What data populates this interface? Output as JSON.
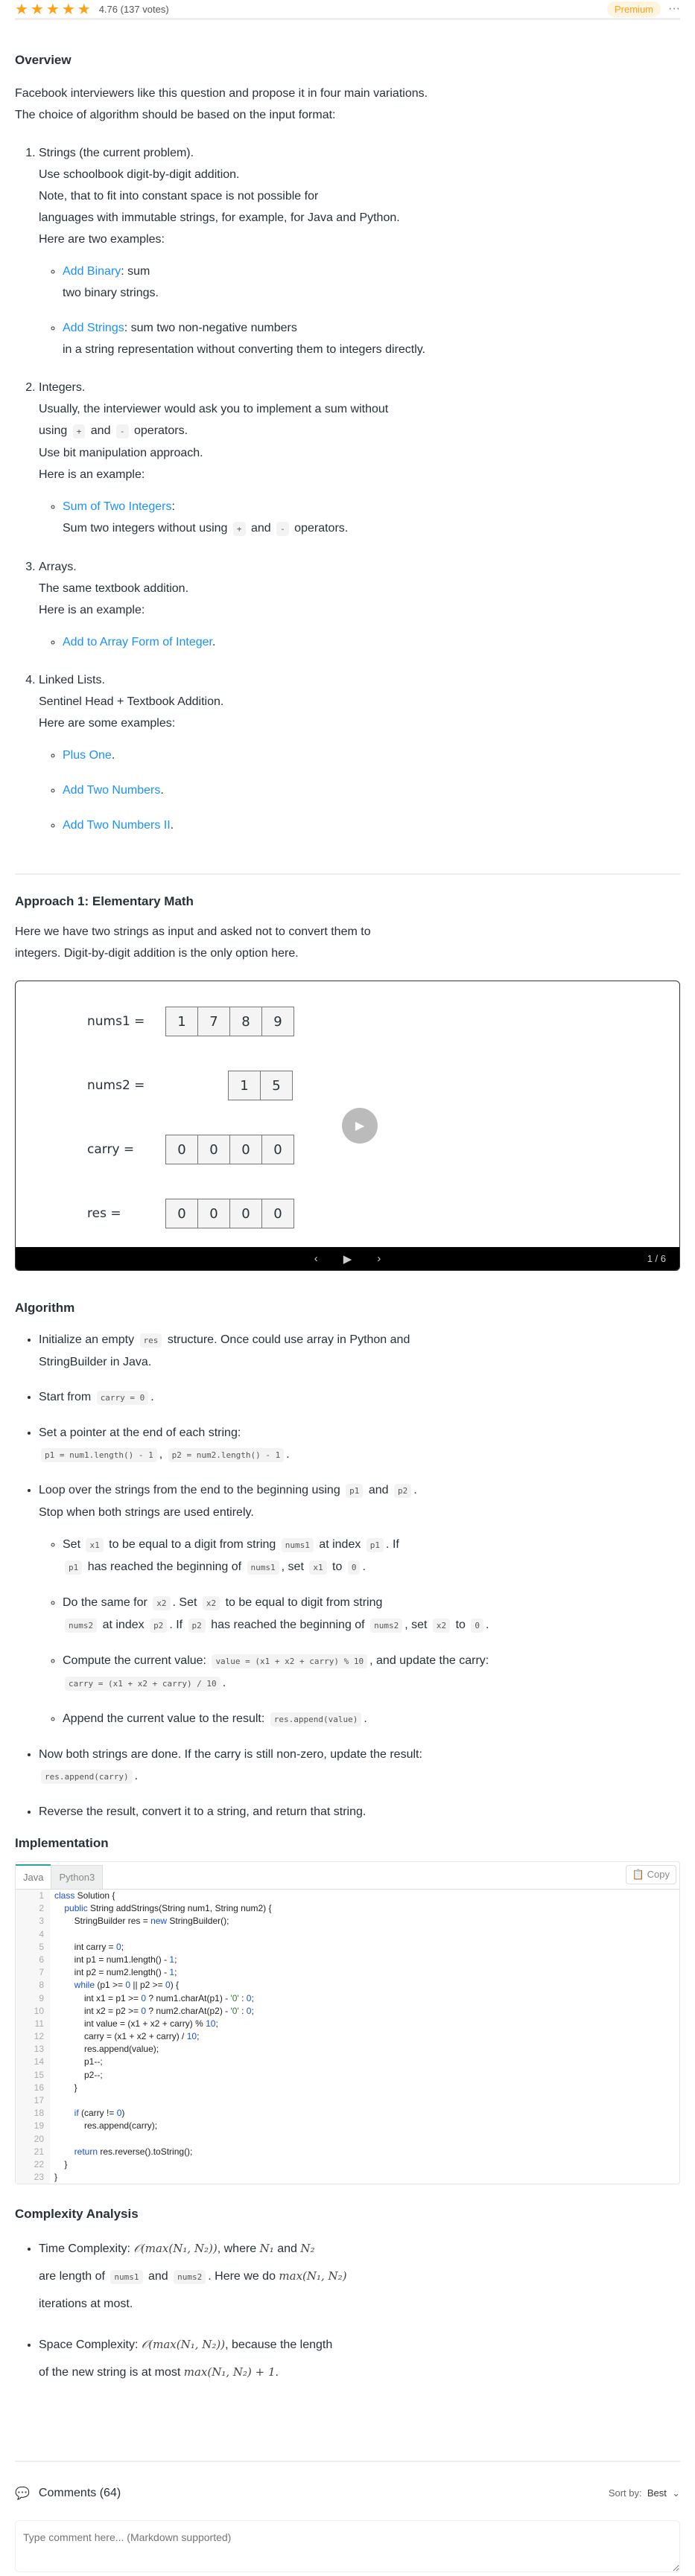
{
  "header": {
    "stars": 5,
    "rating": "4.76",
    "votes": "(137 votes)",
    "premium": "Premium",
    "more": "···"
  },
  "overview": {
    "title": "Overview",
    "intro1": "Facebook interviewers like this question and propose it in four main variations.",
    "intro2": "The choice of algorithm should be based on the input format:",
    "items": [
      {
        "lines": [
          [
            {
              "t": "Strings (the current problem)."
            }
          ],
          [
            {
              "t": "Use schoolbook digit-by-digit addition."
            }
          ],
          [
            {
              "t": "Note, that to fit into constant space is not possible for"
            }
          ],
          [
            {
              "t": "languages with immutable strings, for example, for Java and Python."
            }
          ],
          [
            {
              "t": "Here are two examples:"
            }
          ]
        ],
        "sub": [
          [
            {
              "l": "Add Binary"
            },
            {
              "t": ": sum"
            },
            {
              "br": 1
            },
            {
              "t": "two binary strings."
            }
          ],
          [
            {
              "l": "Add Strings"
            },
            {
              "t": ": sum two non-negative numbers"
            },
            {
              "br": 1
            },
            {
              "t": "in a string representation without converting them to integers directly."
            }
          ]
        ]
      },
      {
        "lines": [
          [
            {
              "t": "Integers."
            }
          ],
          [
            {
              "t": "Usually, the interviewer would ask you to implement a sum without"
            }
          ],
          [
            {
              "t": "using "
            },
            {
              "c": "+"
            },
            {
              "t": " and "
            },
            {
              "c": "-"
            },
            {
              "t": " operators."
            }
          ],
          [
            {
              "t": "Use bit manipulation approach."
            }
          ],
          [
            {
              "t": "Here is an example:"
            }
          ]
        ],
        "sub": [
          [
            {
              "l": "Sum of Two Integers"
            },
            {
              "t": ":"
            },
            {
              "br": 1
            },
            {
              "t": "Sum two integers without using "
            },
            {
              "c": "+"
            },
            {
              "t": " and "
            },
            {
              "c": "-"
            },
            {
              "t": " operators."
            }
          ]
        ]
      },
      {
        "lines": [
          [
            {
              "t": "Arrays."
            }
          ],
          [
            {
              "t": "The same textbook addition."
            }
          ],
          [
            {
              "t": "Here is an example:"
            }
          ]
        ],
        "sub": [
          [
            {
              "l": "Add to Array Form of Integer"
            },
            {
              "t": "."
            }
          ]
        ]
      },
      {
        "lines": [
          [
            {
              "t": "Linked Lists."
            }
          ],
          [
            {
              "t": "Sentinel Head + Textbook Addition."
            }
          ],
          [
            {
              "t": "Here are some examples:"
            }
          ]
        ],
        "sub": [
          [
            {
              "l": "Plus One"
            },
            {
              "t": "."
            }
          ],
          [
            {
              "l": "Add Two Numbers"
            },
            {
              "t": "."
            }
          ],
          [
            {
              "l": "Add Two Numbers II"
            },
            {
              "t": "."
            }
          ]
        ]
      }
    ]
  },
  "approach": {
    "title": "Approach 1: Elementary Math",
    "intro1": "Here we have two strings as input and asked not to convert them to",
    "intro2": "integers. Digit-by-digit addition is the only option here."
  },
  "animation": {
    "rows": [
      {
        "label": "nums1 =",
        "cells": [
          "1",
          "7",
          "8",
          "9"
        ]
      },
      {
        "label": "nums2 =",
        "cells": [
          "1",
          "5"
        ]
      },
      {
        "label": "carry =",
        "cells": [
          "0",
          "0",
          "0",
          "0"
        ]
      },
      {
        "label": "res =",
        "cells": [
          "0",
          "0",
          "0",
          "0"
        ]
      }
    ],
    "page": "1 / 6"
  },
  "algorithm": {
    "title": "Algorithm",
    "items": [
      [
        {
          "t": "Initialize an empty "
        },
        {
          "c": "res"
        },
        {
          "t": " structure. Once could use array in Python and"
        },
        {
          "br": 1
        },
        {
          "t": "StringBuilder in Java."
        }
      ],
      [
        {
          "t": "Start from "
        },
        {
          "c": "carry = 0"
        },
        {
          "t": "."
        }
      ],
      [
        {
          "t": "Set a pointer at the end of each string:"
        },
        {
          "br": 1
        },
        {
          "c": "p1 = num1.length() - 1"
        },
        {
          "t": ", "
        },
        {
          "c": "p2 = num2.length() - 1"
        },
        {
          "t": "."
        }
      ],
      [
        {
          "t": "Loop over the strings from the end to the beginning using "
        },
        {
          "c": "p1"
        },
        {
          "t": " and "
        },
        {
          "c": "p2"
        },
        {
          "t": "."
        },
        {
          "br": 1
        },
        {
          "t": "Stop when both strings are used entirely."
        }
      ]
    ],
    "subitems": [
      [
        {
          "t": "Set "
        },
        {
          "c": "x1"
        },
        {
          "t": " to be equal to a digit from string "
        },
        {
          "c": "nums1"
        },
        {
          "t": " at index "
        },
        {
          "c": "p1"
        },
        {
          "t": ". If"
        },
        {
          "br": 1
        },
        {
          "c": "p1"
        },
        {
          "t": " has reached the beginning of "
        },
        {
          "c": "nums1"
        },
        {
          "t": ", set "
        },
        {
          "c": "x1"
        },
        {
          "t": " to "
        },
        {
          "c": "0"
        },
        {
          "t": "."
        }
      ],
      [
        {
          "t": "Do the same for "
        },
        {
          "c": "x2"
        },
        {
          "t": ". Set "
        },
        {
          "c": "x2"
        },
        {
          "t": " to be equal to digit from string"
        },
        {
          "br": 1
        },
        {
          "c": "nums2"
        },
        {
          "t": " at index "
        },
        {
          "c": "p2"
        },
        {
          "t": ". If "
        },
        {
          "c": "p2"
        },
        {
          "t": " has reached the beginning of "
        },
        {
          "c": "nums2"
        },
        {
          "t": ", set "
        },
        {
          "c": "x2"
        },
        {
          "t": " to "
        },
        {
          "c": "0"
        },
        {
          "t": "."
        }
      ],
      [
        {
          "t": "Compute the current value: "
        },
        {
          "c": "value = (x1 + x2 + carry) % 10"
        },
        {
          "t": ", and update the carry:"
        },
        {
          "br": 1
        },
        {
          "c": "carry = (x1 + x2 + carry) / 10"
        },
        {
          "t": "."
        }
      ],
      [
        {
          "t": "Append the current value to the result: "
        },
        {
          "c": "res.append(value)"
        },
        {
          "t": "."
        }
      ]
    ],
    "after": [
      [
        {
          "t": "Now both strings are done. If the carry is still non-zero, update the result:"
        },
        {
          "br": 1
        },
        {
          "c": "res.append(carry)"
        },
        {
          "t": "."
        }
      ],
      [
        {
          "t": "Reverse the result, convert it to a string, and return that string."
        }
      ]
    ]
  },
  "implementation": {
    "title": "Implementation",
    "tabs": [
      "Java",
      "Python3"
    ],
    "copy": "Copy",
    "code": [
      "class Solution {",
      "    public String addStrings(String num1, String num2) {",
      "        StringBuilder res = new StringBuilder();",
      "",
      "        int carry = 0;",
      "        int p1 = num1.length() - 1;",
      "        int p2 = num2.length() - 1;",
      "        while (p1 >= 0 || p2 >= 0) {",
      "            int x1 = p1 >= 0 ? num1.charAt(p1) - '0' : 0;",
      "            int x2 = p2 >= 0 ? num2.charAt(p2) - '0' : 0;",
      "            int value = (x1 + x2 + carry) % 10;",
      "            carry = (x1 + x2 + carry) / 10;",
      "            res.append(value);",
      "            p1--;",
      "            p2--;",
      "        }",
      "",
      "        if (carry != 0)",
      "            res.append(carry);",
      "",
      "        return res.reverse().toString();",
      "    }",
      "}"
    ]
  },
  "complexity": {
    "title": "Complexity Analysis",
    "items": [
      [
        {
          "t": "Time Complexity: "
        },
        {
          "m": "𝒪(max(N₁, N₂))"
        },
        {
          "t": ", where "
        },
        {
          "m": "N₁"
        },
        {
          "t": " and "
        },
        {
          "m": "N₂"
        },
        {
          "br": 1
        },
        {
          "t": "are length of "
        },
        {
          "c": "nums1"
        },
        {
          "t": " and "
        },
        {
          "c": "nums2"
        },
        {
          "t": ". Here we do "
        },
        {
          "m": "max(N₁, N₂)"
        },
        {
          "br": 1
        },
        {
          "t": "iterations at most."
        }
      ],
      [
        {
          "t": "Space Complexity: "
        },
        {
          "m": "𝒪(max(N₁, N₂))"
        },
        {
          "t": ", because the length"
        },
        {
          "br": 1
        },
        {
          "t": "of the new string is at most "
        },
        {
          "m": "max(N₁, N₂) + 1"
        },
        {
          "t": "."
        }
      ]
    ]
  },
  "comments": {
    "title": "Comments (64)",
    "sort_label": "Sort by:",
    "sort_value": "Best",
    "placeholder": "Type comment here... (Markdown supported)"
  }
}
